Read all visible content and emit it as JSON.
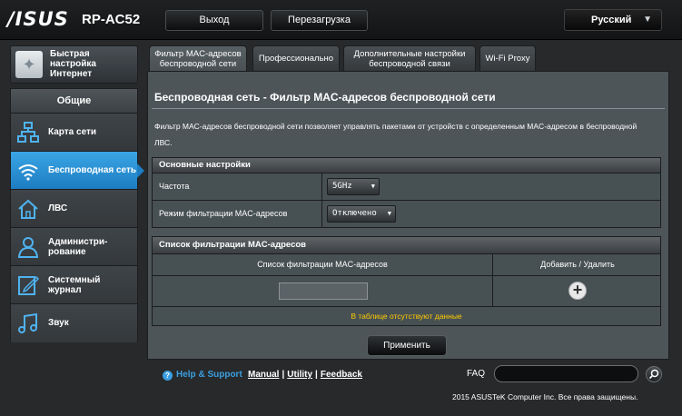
{
  "header": {
    "brand": "/ISUS",
    "model": "RP-AC52",
    "logout_label": "Выход",
    "reboot_label": "Перезагрузка",
    "language": "Русский"
  },
  "sidebar": {
    "quick_setup": "Быстрая настройка Интернет",
    "section_title": "Общие",
    "items": [
      {
        "label": "Карта сети",
        "icon": "network-map-icon"
      },
      {
        "label": "Беспроводная сеть",
        "icon": "wifi-icon",
        "active": true
      },
      {
        "label": "ЛВС",
        "icon": "house-icon"
      },
      {
        "label": "Администри-рование",
        "icon": "admin-user-icon"
      },
      {
        "label": "Системный журнал",
        "icon": "system-log-icon"
      },
      {
        "label": "Звук",
        "icon": "music-note-icon"
      }
    ]
  },
  "tabs": [
    {
      "label": "Фильтр MAC-адресов беспроводной сети",
      "active": true
    },
    {
      "label": "Профессионально"
    },
    {
      "label": "Дополнительные настройки беспроводной связи"
    },
    {
      "label": "Wi-Fi Proxy"
    }
  ],
  "main": {
    "title": "Беспроводная сеть - Фильтр MAC-адресов беспроводной сети",
    "description": "Фильтр MAC-адресов беспроводной сети позволяет управлять пакетами от устройств с определенным MAC-адресом в беспроводной ЛВС.",
    "basic_settings": {
      "header": "Основные настройки",
      "frequency_label": "Частота",
      "frequency_value": "5GHz",
      "filter_mode_label": "Режим фильтрации MAC-адресов",
      "filter_mode_value": "Отключено"
    },
    "filter_list": {
      "header": "Список фильтрации MAC-адресов",
      "col_list": "Список фильтрации MAC-адресов",
      "col_action": "Добавить / Удалить",
      "empty_message": "В таблице отсутствуют данные"
    },
    "apply_label": "Применить"
  },
  "footer": {
    "help_support": "Help & Support",
    "links": [
      "Manual",
      "Utility",
      "Feedback"
    ],
    "faq_label": "FAQ",
    "copyright": "2015 ASUSTeK Computer Inc. Все права защищены."
  },
  "colors": {
    "accent_blue": "#1d7dc2",
    "empty_text_yellow": "#ffcc00"
  }
}
